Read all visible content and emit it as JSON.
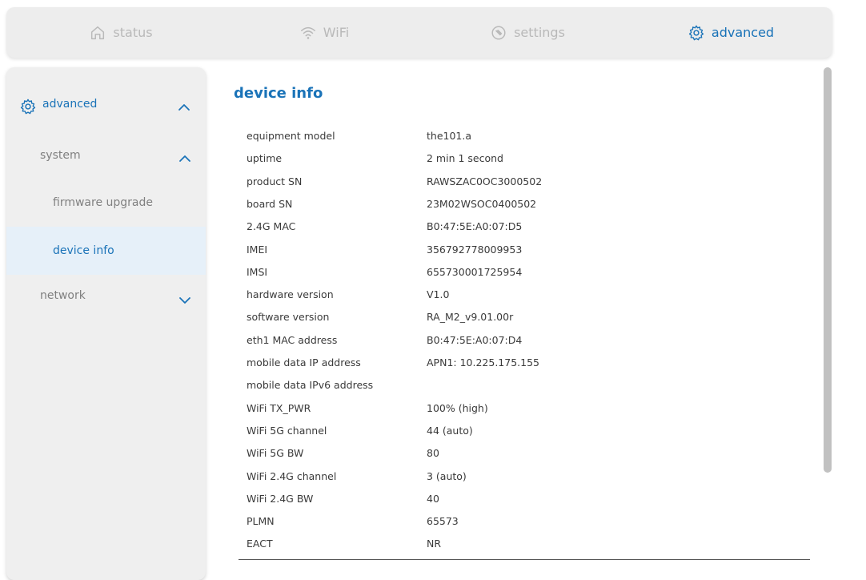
{
  "topnav": {
    "tabs": [
      {
        "label": "status",
        "icon": "home-icon"
      },
      {
        "label": "WiFi",
        "icon": "wifi-icon"
      },
      {
        "label": "settings",
        "icon": "settings-icon"
      },
      {
        "label": "advanced",
        "icon": "gear-icon"
      }
    ],
    "active_index": 3
  },
  "sidebar": {
    "advanced_label": "advanced",
    "system_label": "system",
    "firmware_label": "firmware upgrade",
    "device_info_label": "device info",
    "network_label": "network"
  },
  "main": {
    "title": "device info",
    "rows": [
      {
        "key": "equipment model",
        "value": "the101.a"
      },
      {
        "key": "uptime",
        "value": "2  min  1  second"
      },
      {
        "key": "product SN",
        "value": "RAWSZAC0OC3000502"
      },
      {
        "key": "board SN",
        "value": "23M02WSOC0400502"
      },
      {
        "key": "2.4G MAC",
        "value": "B0:47:5E:A0:07:D5"
      },
      {
        "key": "IMEI",
        "value": "356792778009953"
      },
      {
        "key": "IMSI",
        "value": "655730001725954"
      },
      {
        "key": "hardware version",
        "value": "V1.0"
      },
      {
        "key": "software version",
        "value": "RA_M2_v9.01.00r"
      },
      {
        "key": "eth1 MAC address",
        "value": "B0:47:5E:A0:07:D4"
      },
      {
        "key": "mobile data IP address",
        "value": "APN1: 10.225.175.155"
      },
      {
        "key": "mobile data IPv6 address",
        "value": ""
      },
      {
        "key": "WiFi TX_PWR",
        "value": "100% (high)"
      },
      {
        "key": "WiFi 5G channel",
        "value": "44 (auto)"
      },
      {
        "key": "WiFi 5G BW",
        "value": "80"
      },
      {
        "key": "WiFi 2.4G channel",
        "value": "3 (auto)"
      },
      {
        "key": "WiFi 2.4G BW",
        "value": "40"
      },
      {
        "key": "PLMN",
        "value": "65573"
      },
      {
        "key": "EACT",
        "value": "NR"
      }
    ]
  },
  "colors": {
    "accent": "#1a73b8",
    "muted": "#b9b9b9",
    "panel": "#efefef"
  }
}
